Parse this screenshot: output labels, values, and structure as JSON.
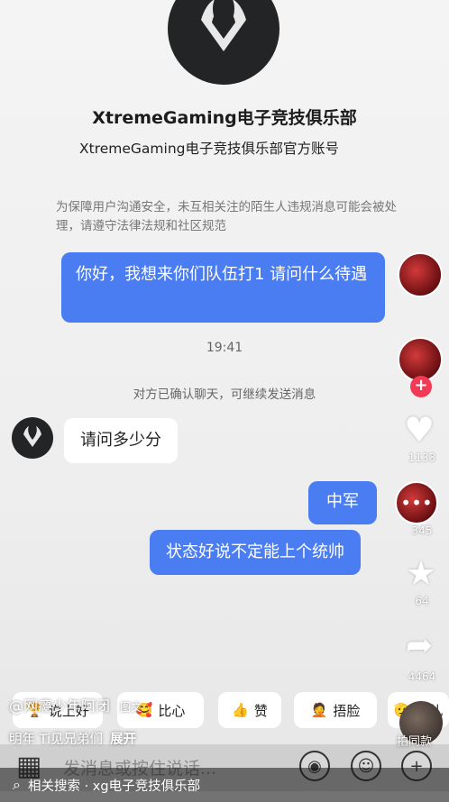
{
  "header": {
    "club_name": "XtremeGaming电子竞技俱乐部",
    "club_desc": "XtremeGaming电子竞技俱乐部官方账号",
    "notice": "为保障用户沟通安全，未互相关注的陌生人违规消息可能会被处理，请遵守法律法规和社区规范"
  },
  "chat": {
    "msg1": "你好，我想来你们队伍打1 请问什么待遇",
    "time": "19:41",
    "system": "对方已确认聊天，可继续发送消息",
    "msg2": "请问多少分",
    "msg3": "中军",
    "msg4": "状态好说不定能上个统帅"
  },
  "side": {
    "like_count": "1133",
    "comment_count": "345",
    "fav_count": "64",
    "share_count": "4464",
    "shoot_label": "拍同款"
  },
  "reactions": [
    {
      "icon": "prize-emoji-icon",
      "label": "说上好"
    },
    {
      "icon": "heart-face-emoji-icon",
      "label": "比心"
    },
    {
      "icon": "thumbs-up-emoji-icon",
      "label": "赞"
    },
    {
      "icon": "facepalm-emoji-icon",
      "label": "捂脸"
    },
    {
      "icon": "more-emoji-icon",
      "label": "敬礼"
    }
  ],
  "overlay": {
    "author": "@网瘾少年阿闭",
    "badge": "图文",
    "caption": "明年 Ti见兄弟们",
    "expand": "展开"
  },
  "input": {
    "placeholder": "发消息或按住说话..."
  },
  "search": {
    "label": "相关搜索 · xg电子竞技俱乐部"
  },
  "colors": {
    "blue_bubble": "#4a7cf2",
    "accent_red": "#f23a55"
  }
}
